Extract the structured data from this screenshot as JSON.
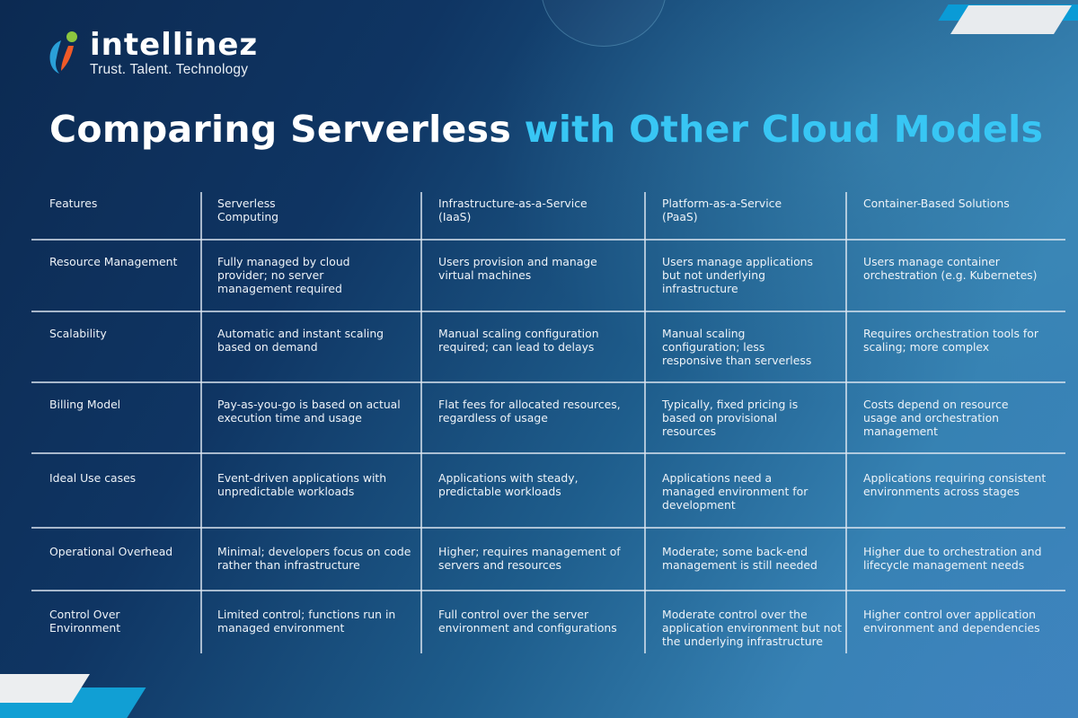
{
  "brand": {
    "name": "intellinez",
    "tagline": "Trust. Talent. Technology",
    "colors": {
      "logo_blue": "#2a9fd8",
      "logo_green": "#8cc63f",
      "logo_orange": "#f05a28",
      "title_accent": "#38c6f4"
    }
  },
  "title": {
    "part1": "Comparing Serverless",
    "part2": "with Other Cloud Models"
  },
  "table": {
    "headers": [
      "Features",
      "Serverless\nComputing",
      "Infrastructure-as-a-Service\n(IaaS)",
      "Platform-as-a-Service\n(PaaS)",
      "Container-Based Solutions"
    ],
    "rows": [
      {
        "feature": "Resource Management",
        "serverless": "Fully managed by cloud provider; no server management required",
        "iaas": "Users provision and manage virtual machines",
        "paas": "Users manage applications but not underlying infrastructure",
        "container": "Users manage container orchestration (e.g. Kubernetes)"
      },
      {
        "feature": "Scalability",
        "serverless": "Automatic and instant scaling based on demand",
        "iaas": "Manual scaling configuration required; can lead to delays",
        "paas": "Manual scaling configuration; less responsive than serverless",
        "container": "Requires orchestration tools for scaling; more complex"
      },
      {
        "feature": "Billing Model",
        "serverless": "Pay-as-you-go is based on actual execution time and usage",
        "iaas": "Flat fees for allocated resources, regardless of usage",
        "paas": "Typically, fixed pricing is based on provisional resources",
        "container": "Costs depend on resource usage and orchestration management"
      },
      {
        "feature": "Ideal Use cases",
        "serverless": "Event-driven applications with unpredictable workloads",
        "iaas": "Applications with steady, predictable workloads",
        "paas": "Applications need a managed environment for development",
        "container": "Applications requiring consistent environments across stages"
      },
      {
        "feature": "Operational Overhead",
        "serverless": "Minimal; developers focus on code rather than infrastructure",
        "iaas": "Higher; requires management of servers and resources",
        "paas": "Moderate; some back-end management is still needed",
        "container": "Higher due to orchestration and lifecycle management needs"
      },
      {
        "feature": "Control Over Environment",
        "serverless": "Limited control; functions run in managed environment",
        "iaas": "Full control over the server environment and configurations",
        "paas": "Moderate control over the application environment but not the underlying infrastructure",
        "container": "Higher control over application environment and dependencies"
      }
    ]
  }
}
